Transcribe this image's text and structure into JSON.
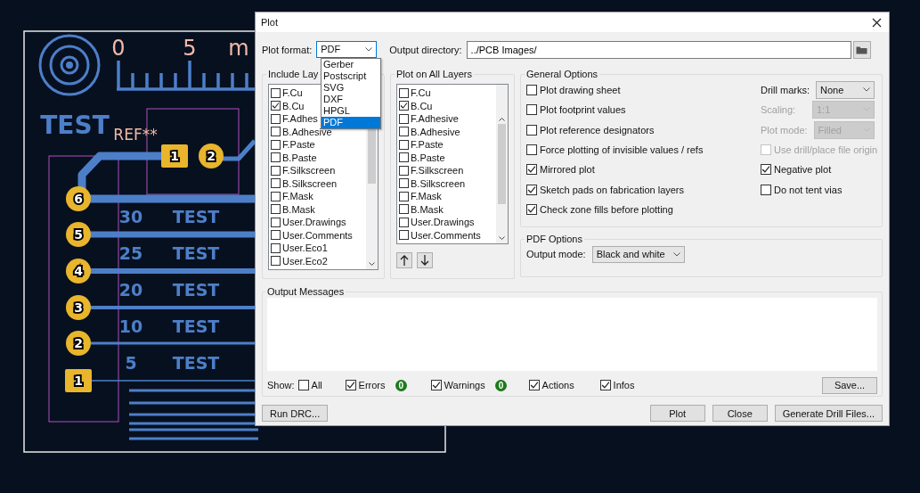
{
  "canvas": {
    "ruler_labels": [
      "0",
      "5",
      "m"
    ],
    "logo_text": "TEST",
    "ref_text": "REF**",
    "pads": [
      {
        "number": "1",
        "kind": "square"
      },
      {
        "number": "2",
        "kind": "round"
      },
      {
        "number": "6",
        "kind": "round"
      },
      {
        "number": "5",
        "kind": "round"
      },
      {
        "number": "4",
        "kind": "round"
      },
      {
        "number": "3",
        "kind": "round"
      },
      {
        "number": "2",
        "kind": "round"
      },
      {
        "number": "1",
        "kind": "square"
      }
    ],
    "row_labels": [
      {
        "value": "30",
        "text": "TEST"
      },
      {
        "value": "25",
        "text": "TEST"
      },
      {
        "value": "20",
        "text": "TEST"
      },
      {
        "value": "10",
        "text": "TEST"
      },
      {
        "value": "5",
        "text": "TEST"
      }
    ]
  },
  "window": {
    "title": "Plot"
  },
  "plot_format": {
    "label": "Plot format:",
    "value": "PDF",
    "options": [
      {
        "label": "Gerber",
        "selected": false
      },
      {
        "label": "Postscript",
        "selected": false
      },
      {
        "label": "SVG",
        "selected": false
      },
      {
        "label": "DXF",
        "selected": false
      },
      {
        "label": "HPGL",
        "selected": false
      },
      {
        "label": "PDF",
        "selected": true
      }
    ]
  },
  "output_directory": {
    "label": "Output directory:",
    "value": "../PCB Images/"
  },
  "include_layers": {
    "title": "Include Lay",
    "layers": [
      {
        "label": "F.Cu",
        "checked": false
      },
      {
        "label": "B.Cu",
        "checked": true
      },
      {
        "label": "F.Adhes",
        "checked": false
      },
      {
        "label": "B.Adhesive",
        "checked": false
      },
      {
        "label": "F.Paste",
        "checked": false
      },
      {
        "label": "B.Paste",
        "checked": false
      },
      {
        "label": "F.Silkscreen",
        "checked": false
      },
      {
        "label": "B.Silkscreen",
        "checked": false
      },
      {
        "label": "F.Mask",
        "checked": false
      },
      {
        "label": "B.Mask",
        "checked": false
      },
      {
        "label": "User.Drawings",
        "checked": false
      },
      {
        "label": "User.Comments",
        "checked": false
      },
      {
        "label": "User.Eco1",
        "checked": false
      },
      {
        "label": "User.Eco2",
        "checked": false
      }
    ]
  },
  "plot_on_all_layers": {
    "title": "Plot on All Layers",
    "layers": [
      {
        "label": "F.Cu",
        "checked": false
      },
      {
        "label": "B.Cu",
        "checked": true
      },
      {
        "label": "F.Adhesive",
        "checked": false
      },
      {
        "label": "B.Adhesive",
        "checked": false
      },
      {
        "label": "F.Paste",
        "checked": false
      },
      {
        "label": "B.Paste",
        "checked": false
      },
      {
        "label": "F.Silkscreen",
        "checked": false
      },
      {
        "label": "B.Silkscreen",
        "checked": false
      },
      {
        "label": "F.Mask",
        "checked": false
      },
      {
        "label": "B.Mask",
        "checked": false
      },
      {
        "label": "User.Drawings",
        "checked": false
      },
      {
        "label": "User.Comments",
        "checked": false
      }
    ]
  },
  "general_options": {
    "title": "General Options",
    "checkboxes": [
      {
        "label": "Plot drawing sheet",
        "checked": false
      },
      {
        "label": "Plot footprint values",
        "checked": false
      },
      {
        "label": "Plot reference designators",
        "checked": false
      },
      {
        "label": "Force plotting of invisible values / refs",
        "checked": false
      },
      {
        "label": "Mirrored plot",
        "checked": true
      },
      {
        "label": "Sketch pads on fabrication layers",
        "checked": true
      },
      {
        "label": "Check zone fills before plotting",
        "checked": true
      }
    ],
    "settings": [
      {
        "kind": "select",
        "label": "Drill marks:",
        "value": "None",
        "disabled": false
      },
      {
        "kind": "select",
        "label": "Scaling:",
        "value": "1:1",
        "disabled": true
      },
      {
        "kind": "select",
        "label": "Plot mode:",
        "value": "Filled",
        "disabled": true
      },
      {
        "kind": "checkbox",
        "label": "Use drill/place file origin",
        "checked": false,
        "disabled": true
      },
      {
        "kind": "checkbox",
        "label": "Negative plot",
        "checked": true,
        "disabled": false
      },
      {
        "kind": "checkbox",
        "label": "Do not tent vias",
        "checked": false,
        "disabled": false
      }
    ]
  },
  "pdf_options": {
    "title": "PDF Options",
    "output_mode": {
      "label": "Output mode:",
      "value": "Black and white"
    }
  },
  "output_messages": {
    "title": "Output Messages",
    "show_label": "Show:",
    "filters": [
      {
        "label": "All",
        "checked": false
      },
      {
        "label": "Errors",
        "checked": true,
        "count": "0"
      },
      {
        "label": "Warnings",
        "checked": true,
        "count": "0"
      },
      {
        "label": "Actions",
        "checked": true
      },
      {
        "label": "Infos",
        "checked": true
      }
    ],
    "save_button": "Save..."
  },
  "buttons": {
    "left": [
      "Run DRC..."
    ],
    "right": [
      "Plot",
      "Close",
      "Generate Drill Files..."
    ]
  }
}
